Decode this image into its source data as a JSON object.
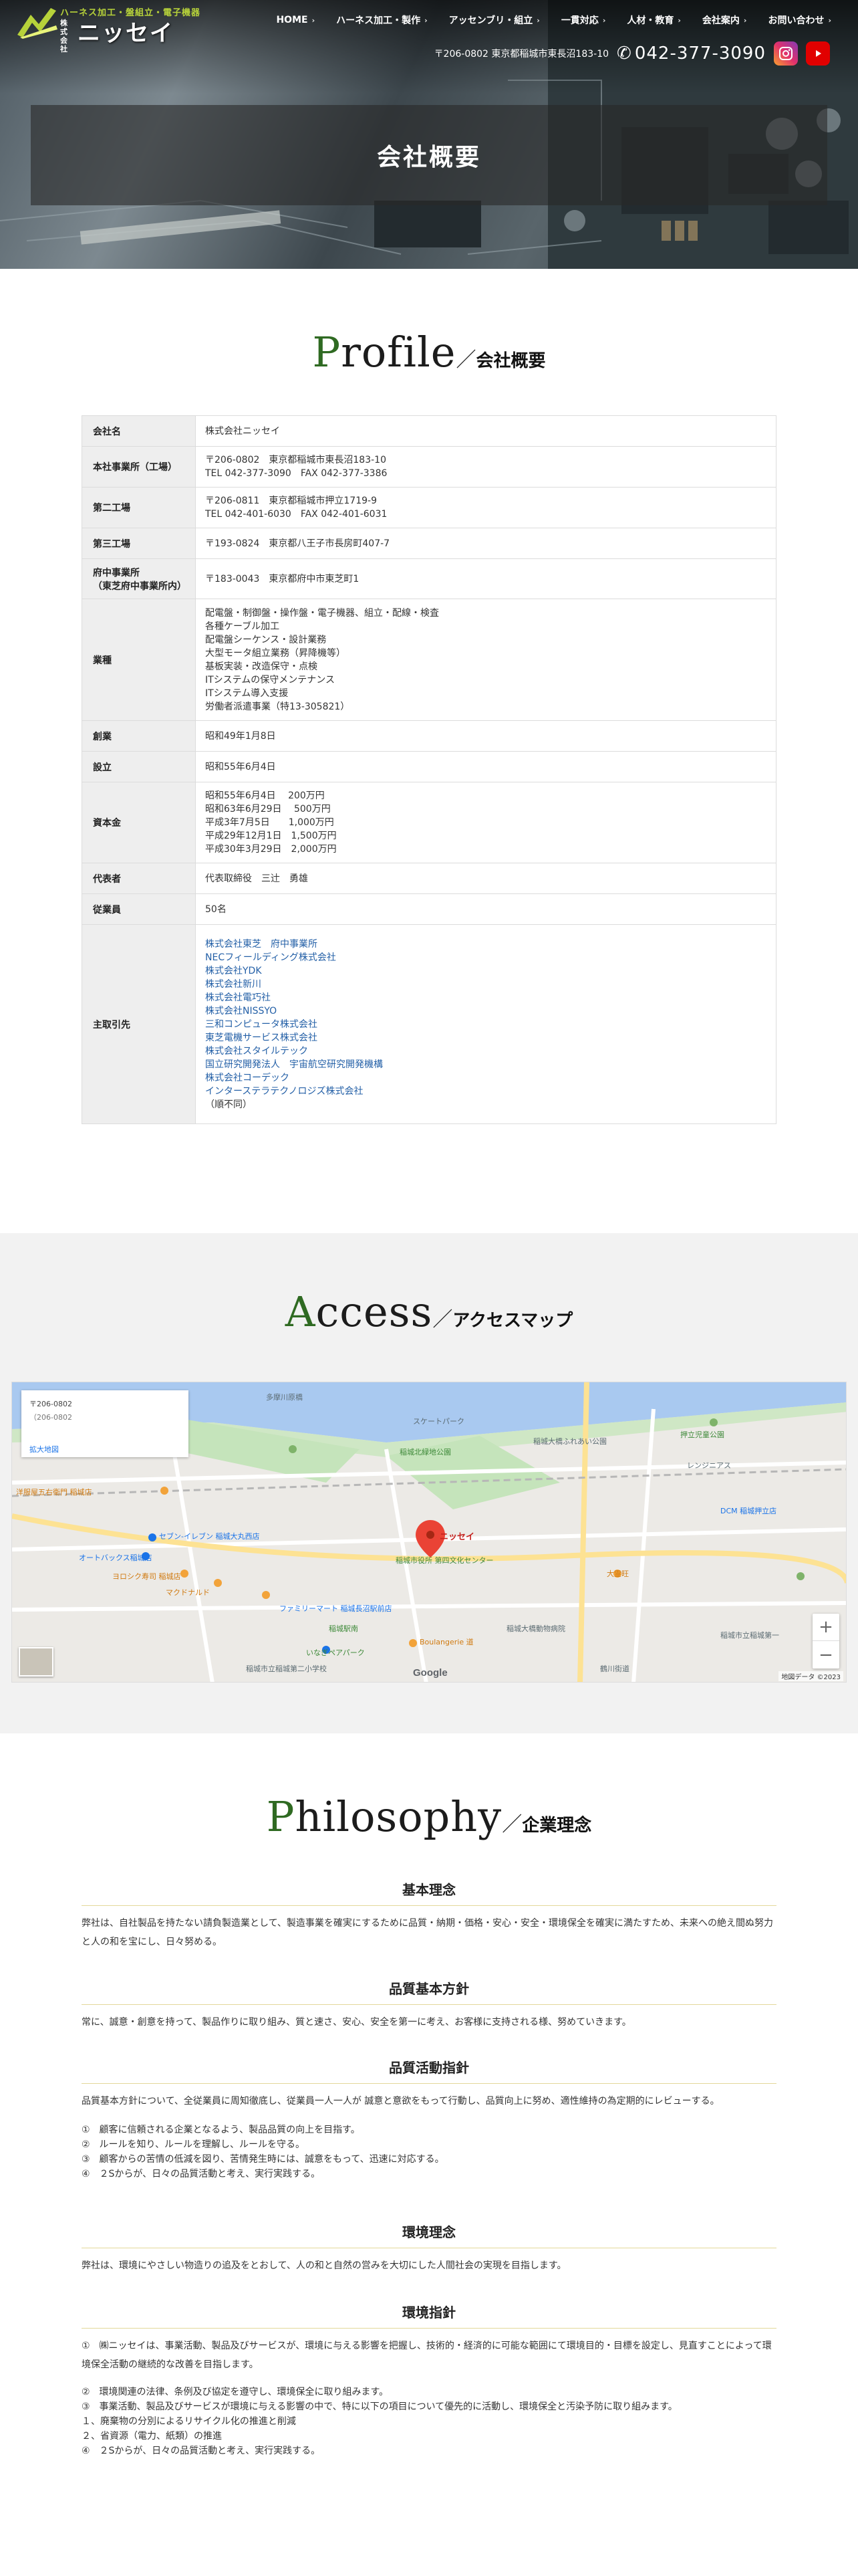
{
  "header": {
    "logo_tagline": "ハーネス加工・盤組立・電子機器",
    "logo_prefix": "株式会社",
    "logo_name": "ニッセイ",
    "nav": [
      {
        "label": "HOME"
      },
      {
        "label": "ハーネス加工・製作"
      },
      {
        "label": "アッセンブリ・組立"
      },
      {
        "label": "一貫対応"
      },
      {
        "label": "人材・教育"
      },
      {
        "label": "会社案内"
      },
      {
        "label": "お問い合わせ"
      }
    ],
    "address": "〒206-0802 東京都稲城市東長沼183-10",
    "tel": "042-377-3090"
  },
  "hero": {
    "title": "会社概要"
  },
  "profile": {
    "heading_first": "P",
    "heading_rest": "rofile",
    "heading_jp": "会社概要",
    "rows": [
      {
        "label": "会社名",
        "lines": [
          "株式会社ニッセイ"
        ]
      },
      {
        "label": "本社事業所（工場）",
        "lines": [
          "〒206-0802　東京都稲城市東長沼183-10",
          "TEL 042-377-3090　FAX 042-377-3386"
        ]
      },
      {
        "label": "第二工場",
        "lines": [
          "〒206-0811　東京都稲城市押立1719-9",
          "TEL 042-401-6030　FAX 042-401-6031"
        ]
      },
      {
        "label": "第三工場",
        "lines": [
          "〒193-0824　東京都八王子市長房町407-7"
        ]
      },
      {
        "label": "府中事業所\n（東芝府中事業所内）",
        "lines": [
          "〒183-0043　東京都府中市東芝町1"
        ]
      },
      {
        "label": "業種",
        "lines": [
          "配電盤・制御盤・操作盤・電子機器、組立・配線・検査",
          "各種ケーブル加工",
          "配電盤シーケンス・設計業務",
          "大型モータ組立業務（昇降機等）",
          "基板実装・改造保守・点検",
          "ITシステムの保守メンテナンス",
          "ITシステム導入支援",
          "労働者派遣事業（特13-305821）"
        ]
      },
      {
        "label": "創業",
        "lines": [
          "昭和49年1月8日"
        ]
      },
      {
        "label": "設立",
        "lines": [
          "昭和55年6月4日"
        ]
      },
      {
        "label": "資本金",
        "lines": [
          "昭和55年6月4日　 200万円",
          "昭和63年6月29日　 500万円",
          "平成3年7月5日　　1,000万円",
          "平成29年12月1日　1,500万円",
          "平成30年3月29日　2,000万円"
        ]
      },
      {
        "label": "代表者",
        "lines": [
          "代表取締役　三辻　勇雄"
        ]
      },
      {
        "label": "従業員",
        "lines": [
          "50名"
        ]
      },
      {
        "label": "主取引先",
        "links": [
          "株式会社東芝　府中事業所",
          "NECフィールディング株式会社",
          "株式会社YDK",
          "株式会社新川",
          "株式会社電巧社",
          "株式会社NISSYO",
          "三和コンピュータ株式会社",
          "東芝電機サービス株式会社",
          "株式会社スタイルテック",
          "国立研究開発法人　宇宙航空研究開発機構",
          "株式会社コーデック",
          "インターステラテクノロジズ株式会社"
        ],
        "note": "（順不同）"
      }
    ]
  },
  "access": {
    "heading_first": "A",
    "heading_rest": "ccess",
    "heading_jp": "アクセスマップ",
    "map": {
      "info_label": "〒206-0802",
      "info_sub": "（206-0802",
      "info_link": "拡大地図",
      "pin_label": "ニッセイ",
      "google": "Google",
      "copyright": "地図データ ©2023",
      "places": [
        "多摩川原橋",
        "スケートパーク",
        "稲城北緑地公園",
        "稲城大橋ふれあい公園",
        "押立児童公園",
        "レンジニアス",
        "DCM 稲城押立店",
        "洋服屋五右衛門 稲城店",
        "セブン-イレブン 稲城大丸西店",
        "オートバックス稲城店",
        "ヨロシク寿司 稲城店",
        "マクドナルド",
        "稲城市役所 第四文化センター",
        "大霊旺",
        "ファミリーマート 稲城長沼駅前店",
        "稲城駅南",
        "Boulangerie 道",
        "稲城大橋動物病院",
        "稲城市立稲城第二小学校",
        "いなぎペアパーク",
        "稲城市立稲城第一",
        "鶴川街道"
      ]
    }
  },
  "philosophy": {
    "heading_first": "P",
    "heading_rest": "hilosophy",
    "heading_jp": "企業理念",
    "sections": [
      {
        "title": "基本理念",
        "paras": [
          "弊社は、自社製品を持たない請負製造業として、製造事業を確実にするために品質・納期・価格・安心・安全・環境保全を確実に満たすため、未来への絶え間ぬ努力と人の和を宝にし、日々努める。"
        ]
      },
      {
        "title": "品質基本方針",
        "paras": [
          "常に、誠意・創意を持って、製品作りに取り組み、質と速さ、安心、安全を第一に考え、お客様に支持される様、努めていきます。"
        ]
      },
      {
        "title": "品質活動指針",
        "paras": [
          "品質基本方針について、全従業員に周知徹底し、従業員一人一人が 誠意と意欲をもって行動し、品質向上に努め、適性維持の為定期的にレビューする。"
        ],
        "items": [
          "①　顧客に信頼される企業となるよう、製品品質の向上を目指す。",
          "②　ルールを知り、ルールを理解し、ルールを守る。",
          "③　顧客からの苦情の低減を図り、苦情発生時には、誠意をもって、迅速に対応する。",
          "④　２Sからが、日々の品質活動と考え、実行実践する。"
        ]
      },
      {
        "title": "環境理念",
        "paras": [
          "弊社は、環境にやさしい物造りの追及をとおして、人の和と自然の営みを大切にした人間社会の実現を目指します。"
        ]
      },
      {
        "title": "環境指針",
        "paras": [
          "①　㈱ニッセイは、事業活動、製品及びサービスが、環境に与える影響を把握し、技術的・経済的に可能な範囲にて環境目的・目標を設定し、見直すことによって環境保全活動の継続的な改善を目指します。"
        ],
        "items": [
          "②　環境関連の法律、条例及び協定を遵守し、環境保全に取り組みます。",
          "③　事業活動、製品及びサービスが環境に与える影響の中で、特に以下の項目について優先的に活動し、環境保全と汚染予防に取り組みます。",
          "１、廃棄物の分別によるリサイクル化の推進と削減",
          "２、省資源（電力、紙類）の推進",
          "④　２Sからが、日々の品質活動と考え、実行実践する。"
        ]
      }
    ]
  }
}
